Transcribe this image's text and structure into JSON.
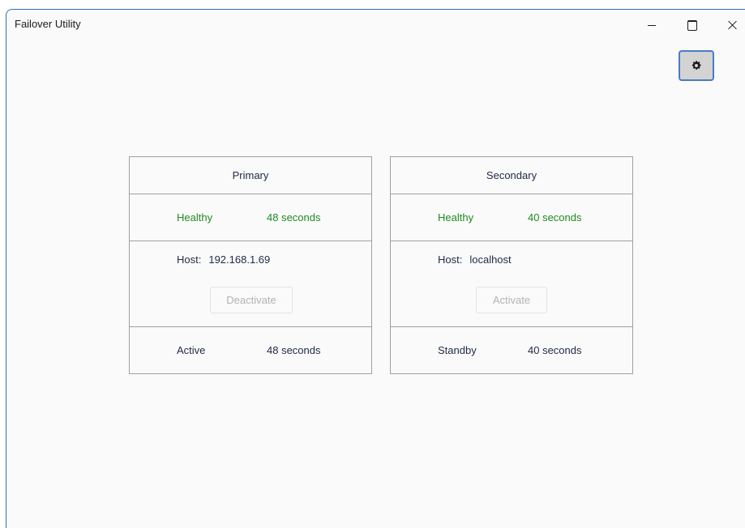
{
  "window": {
    "title": "Failover Utility"
  },
  "controls": {
    "minimize_icon": "minimize-icon",
    "maximize_icon": "maximize-icon",
    "close_icon": "close-icon",
    "settings_icon": "gear-icon"
  },
  "colors": {
    "healthy": "#208a20",
    "text": "#1f2a44",
    "border": "#a0a0a0",
    "disabled_text": "#b3b3b3",
    "settings_border": "#4a7bc8"
  },
  "panels": {
    "primary": {
      "title": "Primary",
      "health_status": "Healthy",
      "health_duration": "48 seconds",
      "host_label": "Host:",
      "host_value": "192.168.1.69",
      "action_label": "Deactivate",
      "state": "Active",
      "state_duration": "48 seconds"
    },
    "secondary": {
      "title": "Secondary",
      "health_status": "Healthy",
      "health_duration": "40 seconds",
      "host_label": "Host:",
      "host_value": "localhost",
      "action_label": "Activate",
      "state": "Standby",
      "state_duration": "40 seconds"
    }
  }
}
